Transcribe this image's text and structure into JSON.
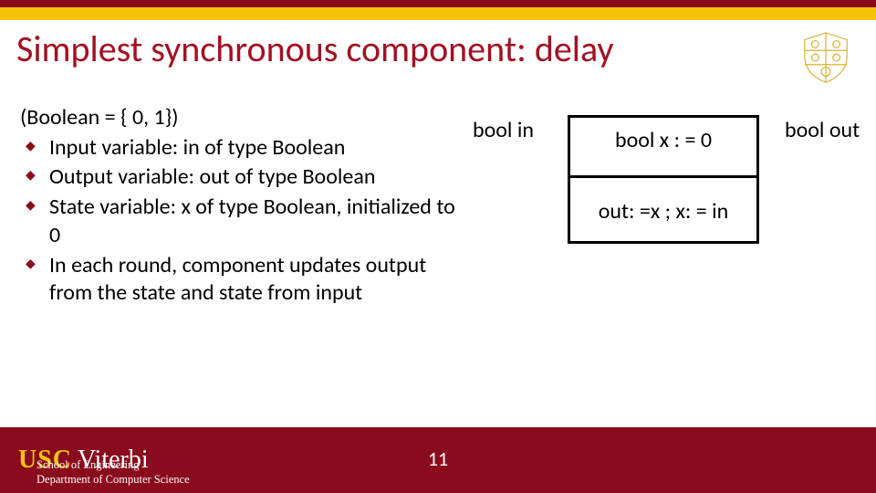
{
  "title": "Simplest synchronous component: delay",
  "definition": "(Boolean = { 0, 1})",
  "bullets": [
    "Input variable: in of type Boolean",
    "Output variable: out of type Boolean",
    "State variable: x of type Boolean, initialized to 0",
    "In each round, component updates output from the state and state from input"
  ],
  "diagram": {
    "in_label": "bool in",
    "out_label": "bool out",
    "box_top": "bool x : = 0",
    "box_bottom": "out: =x ; x: = in"
  },
  "footer": {
    "org1": "USC",
    "org2": "Viterbi",
    "dept_line1": "School of Engineering",
    "dept_line2": "Department of Computer Science",
    "page": "11"
  }
}
